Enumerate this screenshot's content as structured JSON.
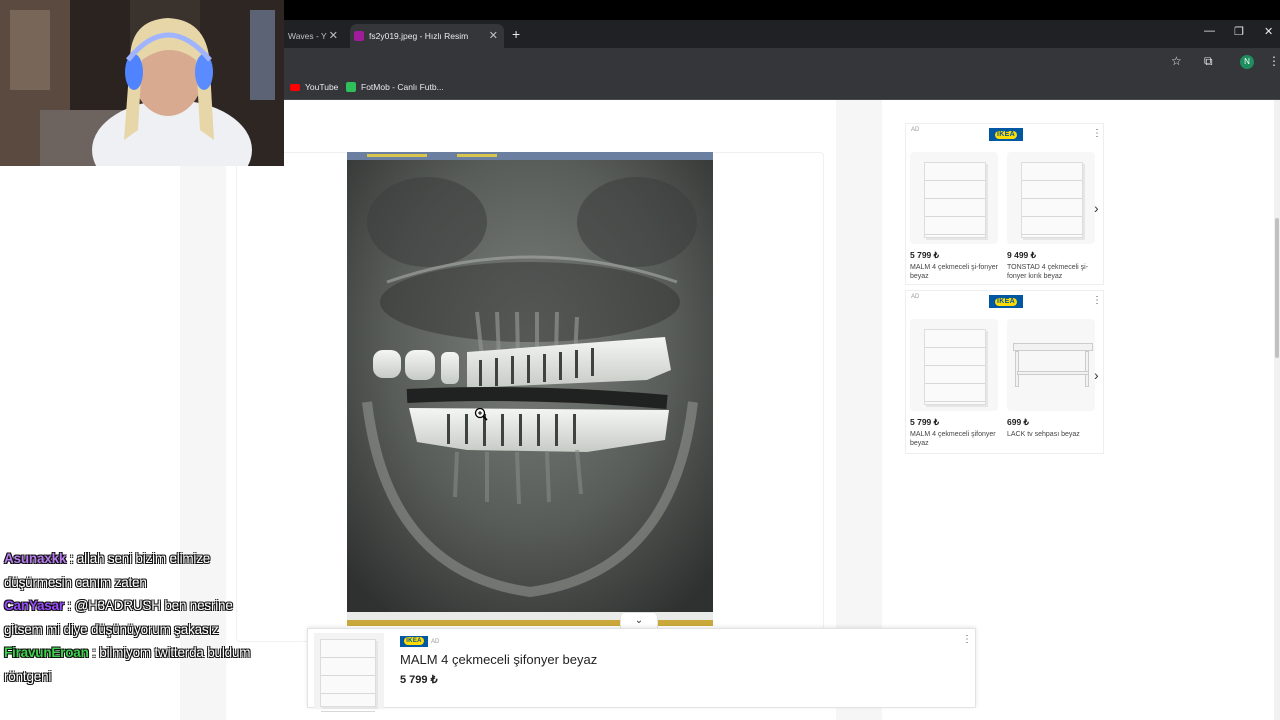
{
  "browser": {
    "tabs": [
      {
        "label": "Waves - Y",
        "active": false
      },
      {
        "label": "fs2y019.jpeg - Hızlı Resim",
        "active": true
      }
    ],
    "new_tab_label": "+",
    "profile_initial": "N",
    "bookmarks": [
      {
        "label": "YouTube",
        "icon": "youtube-icon"
      },
      {
        "label": "FotMob - Canlı Futb...",
        "icon": "fotmob-icon"
      }
    ]
  },
  "ads": {
    "ad_tag": "AD",
    "brand": "IKEA",
    "top_box": {
      "products": [
        {
          "price": "5 799 ₺",
          "name": "MALM 4 çekmeceli şi-fonyer beyaz"
        },
        {
          "price": "9 499 ₺",
          "name": "TONSTAD 4 çekmeceli şi-fonyer kırık beyaz"
        }
      ]
    },
    "second_box": {
      "products": [
        {
          "price": "5 799 ₺",
          "name": "MALM 4 çekmeceli şifonyer beyaz"
        },
        {
          "price": "699 ₺",
          "name": "LACK tv sehpası beyaz"
        }
      ]
    },
    "bottom": {
      "title": "MALM 4 çekmeceli şifonyer beyaz",
      "price": "5 799 ₺"
    }
  },
  "chat": [
    {
      "user": "Asunaxkk",
      "color": "#b77cf0",
      "text": " : allah seni bizim elimize düşürmesin canım zaten"
    },
    {
      "user": "CanYasar",
      "color": "#9a4dff",
      "text": " : @H3ADRUSH ben nesrine gitsem mi diye düşünüyorum şakasız"
    },
    {
      "user": "FiravunEroan",
      "color": "#3bd14a",
      "text": " : bilmiyom twitterda buldum röntgeni"
    }
  ]
}
